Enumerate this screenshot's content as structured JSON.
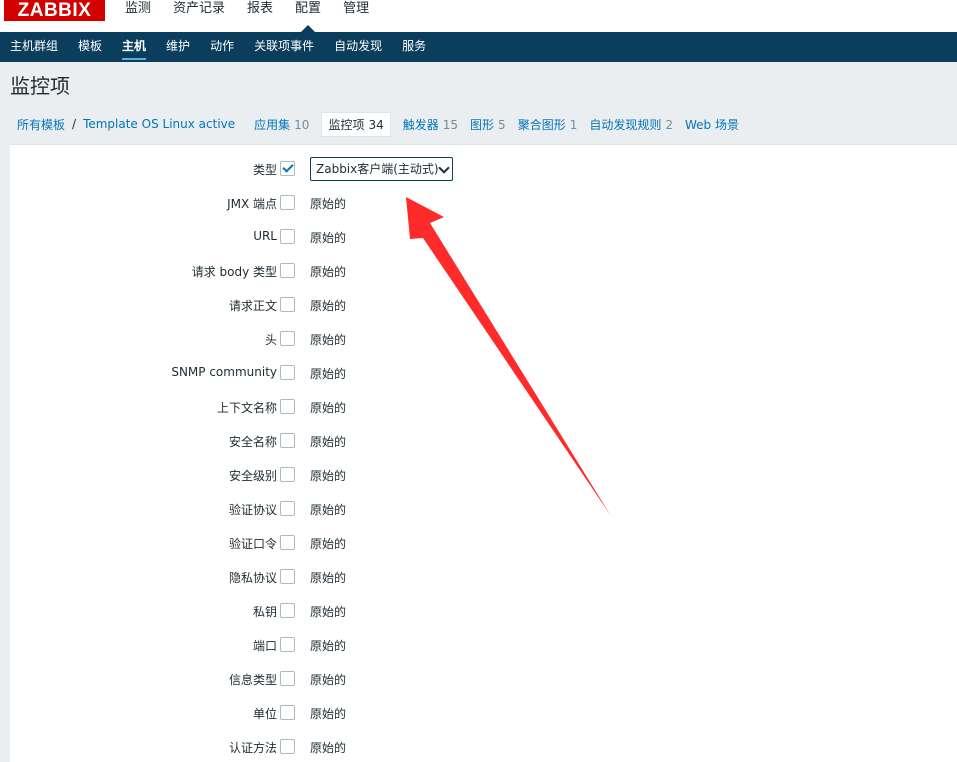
{
  "header": {
    "logo": "ZABBIX",
    "main_nav": [
      "监测",
      "资产记录",
      "报表",
      "配置",
      "管理"
    ],
    "main_nav_active": 3
  },
  "subnav": {
    "items": [
      "主机群组",
      "模板",
      "主机",
      "维护",
      "动作",
      "关联项事件",
      "自动发现",
      "服务"
    ],
    "active": 2
  },
  "page": {
    "title": "监控项"
  },
  "breadcrumb": {
    "all_templates": "所有模板",
    "separator": "/",
    "template": "Template OS Linux active"
  },
  "tabs": [
    {
      "label": "应用集",
      "count": "10"
    },
    {
      "label": "监控项",
      "count": "34",
      "active": true
    },
    {
      "label": "触发器",
      "count": "15"
    },
    {
      "label": "图形",
      "count": "5"
    },
    {
      "label": "聚合图形",
      "count": "1"
    },
    {
      "label": "自动发现规则",
      "count": "2"
    },
    {
      "label": "Web 场景",
      "count": ""
    }
  ],
  "form": {
    "type_row": {
      "label": "类型",
      "checked": true,
      "selected": "Zabbix客户端(主动式)"
    },
    "rows": [
      {
        "label": "JMX 端点",
        "value": "原始的"
      },
      {
        "label": "URL",
        "value": "原始的"
      },
      {
        "label": "请求 body 类型",
        "value": "原始的"
      },
      {
        "label": "请求正文",
        "value": "原始的"
      },
      {
        "label": "头",
        "value": "原始的"
      },
      {
        "label": "SNMP community",
        "value": "原始的"
      },
      {
        "label": "上下文名称",
        "value": "原始的"
      },
      {
        "label": "安全名称",
        "value": "原始的"
      },
      {
        "label": "安全级别",
        "value": "原始的"
      },
      {
        "label": "验证协议",
        "value": "原始的"
      },
      {
        "label": "验证口令",
        "value": "原始的"
      },
      {
        "label": "隐私协议",
        "value": "原始的"
      },
      {
        "label": "私钥",
        "value": "原始的"
      },
      {
        "label": "端口",
        "value": "原始的"
      },
      {
        "label": "信息类型",
        "value": "原始的"
      },
      {
        "label": "单位",
        "value": "原始的"
      },
      {
        "label": "认证方法",
        "value": "原始的"
      }
    ]
  },
  "colors": {
    "brand_red": "#d40000",
    "nav_dark": "#0b3d5c",
    "link_blue": "#0275b8",
    "arrow_red": "#ff2a2a"
  }
}
